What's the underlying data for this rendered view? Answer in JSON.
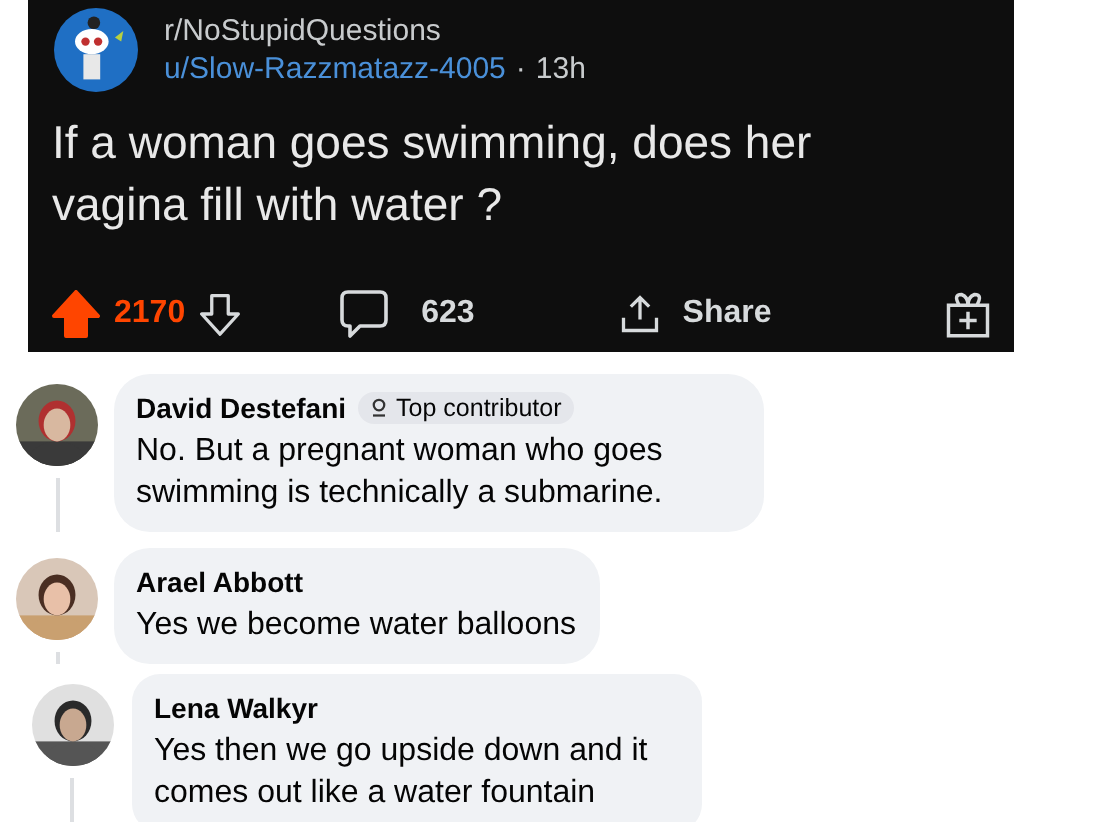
{
  "post": {
    "subreddit": "r/NoStupidQuestions",
    "author": "u/Slow-Razzmatazz-4005",
    "separator": "·",
    "age": "13h",
    "title": "If a woman goes swimming, does her vagina fill with water ?",
    "upvoted": true,
    "score": "2170",
    "comments": "623",
    "share": "Share"
  },
  "comments": [
    {
      "name": "David Destefani",
      "badge": "Top contributor",
      "text": "No. But a pregnant woman who goes swimming is technically a submarine."
    },
    {
      "name": "Arael Abbott",
      "text": "Yes we become water balloons"
    },
    {
      "name": "Lena Walkyr",
      "text": "Yes then we go upside down and it comes out like a water fountain"
    }
  ]
}
